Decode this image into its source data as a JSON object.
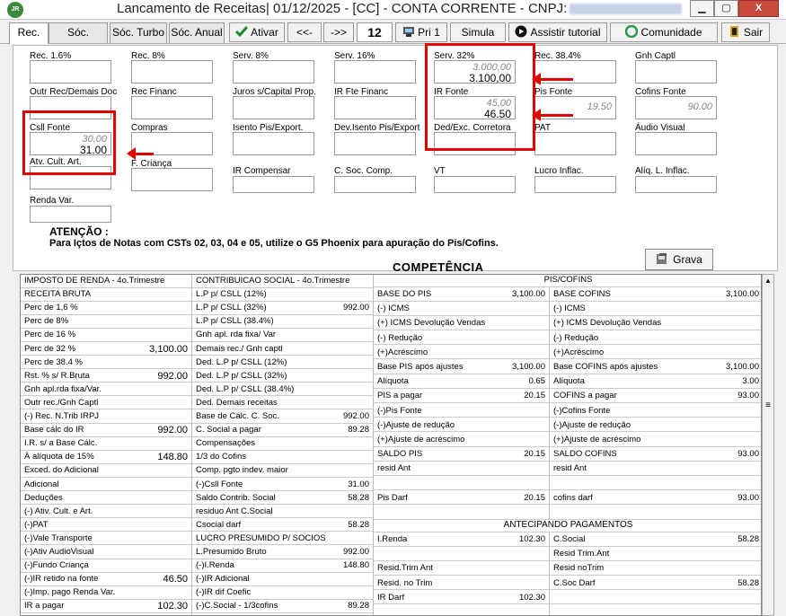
{
  "window": {
    "title": "Lancamento de Receitas|  01/12/2025 - [CC] - CONTA CORRENTE - CNPJ:",
    "app_icon": "JR",
    "min": "▁",
    "max": "▢",
    "close": "X"
  },
  "toolbar": {
    "tabs": [
      "Rec.",
      "Sóc. Normal",
      "Sóc. Turbo",
      "Sóc. Anual"
    ],
    "ativar": "Ativar",
    "prev": "<<-",
    "next": "->>",
    "page": "12",
    "pri": "Pri 1",
    "simula": "Simula",
    "tutorial": "Assistir tutorial",
    "comunidade": "Comunidade",
    "sair": "Sair"
  },
  "fields": {
    "rec16": {
      "label": "Rec. 1.6%"
    },
    "rec8": {
      "label": "Rec. 8%"
    },
    "serv8": {
      "label": "Serv. 8%"
    },
    "serv16": {
      "label": "Serv. 16%"
    },
    "serv32": {
      "label": "Serv. 32%",
      "v1": "3.000,00",
      "v2": "3.100,00"
    },
    "rec384": {
      "label": "Rec. 38.4%"
    },
    "gnh": {
      "label": "Gnh Captl"
    },
    "outr": {
      "label": "Outr Rec/Demais Doc"
    },
    "recfin": {
      "label": "Rec Financ"
    },
    "juros": {
      "label": "Juros s/Capital Prop."
    },
    "irfte": {
      "label": "IR Fte Financ"
    },
    "irfonte": {
      "label": "IR Fonte",
      "v1": "45,00",
      "v2": "46.50"
    },
    "pisfonte": {
      "label": "Pis Fonte",
      "v": "19.50"
    },
    "cofins": {
      "label": "Cofins Fonte",
      "v": "90.00"
    },
    "csll": {
      "label": "Csll Fonte",
      "v1": "30,00",
      "v2": "31.00"
    },
    "compras": {
      "label": "Compras"
    },
    "isento": {
      "label": "Isento Pis/Export."
    },
    "devisento": {
      "label": "Dev.Isento Pis/Export"
    },
    "ded": {
      "label": "Ded/Exc. Corretora"
    },
    "pat": {
      "label": "PAT"
    },
    "audio": {
      "label": "Áudio Visual"
    },
    "atv": {
      "label": "Atv. Cult. Art."
    },
    "fcrianca": {
      "label": "F. Criança"
    },
    "ircomp": {
      "label": "IR Compensar"
    },
    "csoc": {
      "label": "C. Soc. Comp."
    },
    "vt": {
      "label": "VT"
    },
    "lucro": {
      "label": "Lucro Inflac."
    },
    "aliq": {
      "label": "Alíq. L. Inflac."
    },
    "renda": {
      "label": "Renda Var."
    }
  },
  "attention": {
    "title": "ATENÇÃO :",
    "text": "Para Içtos de Notas com CSTs 02, 03, 04 e 05, utilize o G5 Phoenix para apuração do Pis/Cofins."
  },
  "grava": "Grava",
  "competencia": "COMPETÊNCIA",
  "col1": [
    [
      "IMPOSTO DE RENDA - 4o.Trimestre",
      ""
    ],
    [
      "RECEITA BRUTA",
      ""
    ],
    [
      "Perc de 1,6 %",
      ""
    ],
    [
      "Perc de 8%",
      ""
    ],
    [
      "Perc de 16 %",
      ""
    ],
    [
      "Perc de 32 %",
      "3,100.00"
    ],
    [
      "Perc de 38.4 %",
      ""
    ],
    [
      "Rst. % s/ R.Bruta",
      "992.00"
    ],
    [
      "Gnh apl.rda fixa/Var.",
      ""
    ],
    [
      "Outr rec./Gnh Captl",
      ""
    ],
    [
      "(-) Rec. N.Trib IRPJ",
      ""
    ],
    [
      "Base cálc do IR",
      "992.00"
    ],
    [
      "I.R. s/ a Base  Cálc.",
      ""
    ],
    [
      "À alíquota de 15%",
      "148.80"
    ],
    [
      "Exced. do Adicional",
      ""
    ],
    [
      "Adicional",
      ""
    ],
    [
      "Deduções",
      ""
    ],
    [
      "(-) Ativ. Cult. e Art.",
      ""
    ],
    [
      "(-)PAT",
      ""
    ],
    [
      "(-)Vale Transporte",
      ""
    ],
    [
      "(-)Ativ AudioVisual",
      ""
    ],
    [
      "(-)Fundo Criança",
      ""
    ],
    [
      "(-)IR retido na fonte",
      "46.50"
    ],
    [
      "(-)Imp. pago Renda Var.",
      ""
    ],
    [
      "IR a pagar",
      "102.30"
    ]
  ],
  "col2": [
    [
      "CONTRIBUICAO SOCIAL - 4o.Trimestre",
      ""
    ],
    [
      "L.P p/ CSLL (12%)",
      ""
    ],
    [
      "L.P p/ CSLL (32%)",
      "992.00"
    ],
    [
      "L.P p/ CSLL (38.4%)",
      ""
    ],
    [
      "Gnh apl. rda fixa/ Var",
      ""
    ],
    [
      "Demais rec./ Gnh captl",
      ""
    ],
    [
      "Ded. L.P p/ CSLL (12%)",
      ""
    ],
    [
      "Ded. L.P p/ CSLL (32%)",
      ""
    ],
    [
      "Ded. L.P p/ CSLL (38.4%)",
      ""
    ],
    [
      "Ded. Demais receitas",
      ""
    ],
    [
      "Base de Cálc. C. Soc.",
      "992.00"
    ],
    [
      "C. Social a pagar",
      "89.28"
    ],
    [
      "Compensações",
      ""
    ],
    [
      "1/3 do Cofins",
      ""
    ],
    [
      "Comp. pgto indev. maior",
      ""
    ],
    [
      "(-)Csll Fonte",
      "31.00"
    ],
    [
      "Saldo Contrib. Social",
      "58.28"
    ],
    [
      "residuo Ant C.Social",
      ""
    ],
    [
      "Csocial darf",
      "58.28"
    ],
    [
      "LUCRO  PRESUMIDO  P/  SOCIOS",
      ""
    ],
    [
      "L.Presumido Bruto",
      "992.00"
    ],
    [
      "(-)I.Renda",
      "148.80"
    ],
    [
      "(-)IR Adicional",
      ""
    ],
    [
      "(-)IR dif Coefic",
      ""
    ],
    [
      "(-)C.Social - 1/3cofins",
      "89.28"
    ]
  ],
  "pis_header": "PIS/COFINS",
  "col3": [
    [
      "BASE DO PIS",
      "3,100.00"
    ],
    [
      "(-) ICMS",
      ""
    ],
    [
      "(+) ICMS Devolução Vendas",
      ""
    ],
    [
      "(-) Redução",
      ""
    ],
    [
      "(+)Acréscimo",
      ""
    ],
    [
      "Base PIS após ajustes",
      "3,100.00"
    ],
    [
      "Alíquota",
      "0.65"
    ],
    [
      "PIS a pagar",
      "20.15"
    ],
    [
      "(-)Pis Fonte",
      ""
    ],
    [
      "(-)Ajuste de redução",
      ""
    ],
    [
      "(+)Ajuste de acréscimo",
      ""
    ],
    [
      "SALDO PIS",
      "20.15"
    ],
    [
      "resid Ant",
      ""
    ],
    [
      "",
      ""
    ],
    [
      "Pis Darf",
      "20.15"
    ]
  ],
  "col4": [
    [
      "BASE COFINS",
      "3,100.00"
    ],
    [
      "(-) ICMS",
      ""
    ],
    [
      "(+) ICMS Devolução Vendas",
      ""
    ],
    [
      "(-) Redução",
      ""
    ],
    [
      "(+)Acréscimo",
      ""
    ],
    [
      "Base COFINS após ajustes",
      "3,100.00"
    ],
    [
      "Alíquota",
      "3.00"
    ],
    [
      "COFINS a pagar",
      "93.00"
    ],
    [
      "(-)Cofins Fonte",
      ""
    ],
    [
      "(-)Ajuste de redução",
      ""
    ],
    [
      "(+)Ajuste de acréscimo",
      ""
    ],
    [
      "SALDO COFINS",
      "93.00"
    ],
    [
      "resid Ant",
      ""
    ],
    [
      "",
      ""
    ],
    [
      "cofins darf",
      "93.00"
    ]
  ],
  "antecip_header": "ANTECIPANDO PAGAMENTOS",
  "col3b": [
    [
      "I.Renda",
      "102.30"
    ],
    [
      "",
      ""
    ],
    [
      "Resid.Trim Ant",
      ""
    ],
    [
      "Resid. no Trim",
      ""
    ],
    [
      "IR Darf",
      "102.30"
    ]
  ],
  "col4b": [
    [
      "C.Social",
      "58.28"
    ],
    [
      "Resid Trim.Ant",
      ""
    ],
    [
      "Resid noTrim",
      ""
    ],
    [
      "C.Soc Darf",
      "58.28"
    ],
    [
      "",
      ""
    ]
  ]
}
